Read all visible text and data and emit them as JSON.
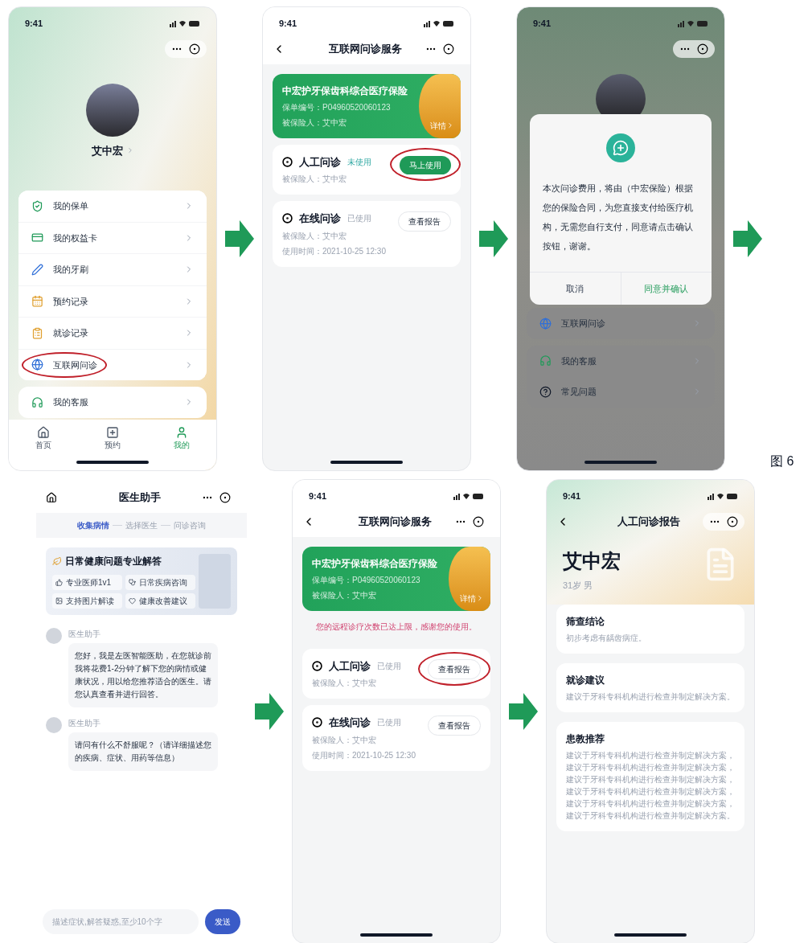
{
  "figure_label": "图 6",
  "screens": [
    {
      "kind": "profile",
      "time": "9:41",
      "user_name": "艾中宏",
      "menu": [
        {
          "label": "我的保单",
          "circled": false
        },
        {
          "label": "我的权益卡",
          "circled": false
        },
        {
          "label": "我的牙刷",
          "circled": false
        },
        {
          "label": "预约记录",
          "circled": false
        },
        {
          "label": "就诊记录",
          "circled": false
        },
        {
          "label": "互联网问诊",
          "circled": true
        }
      ],
      "service_menu": [
        {
          "label": "我的客服"
        }
      ],
      "tabs": [
        {
          "label": "首页",
          "selected": false
        },
        {
          "label": "预约",
          "selected": false
        },
        {
          "label": "我的",
          "selected": true
        }
      ]
    },
    {
      "kind": "service",
      "time": "9:41",
      "title": "互联网问诊服务",
      "card": {
        "title": "中宏护牙保齿科综合医疗保险",
        "number": "保单编号：P04960520060123",
        "insured": "被保险人：艾中宏",
        "detail": "详情"
      },
      "services": [
        {
          "name": "人工问诊",
          "status": "未使用",
          "used": false,
          "lines": [
            "被保险人：艾中宏"
          ],
          "button": {
            "label": "马上使用",
            "primary": true,
            "circled": true
          }
        },
        {
          "name": "在线问诊",
          "status": "已使用",
          "used": true,
          "lines": [
            "被保险人：艾中宏",
            "使用时间：2021-10-25 12:30"
          ],
          "button": {
            "label": "查看报告",
            "primary": false,
            "circled": false
          }
        }
      ]
    },
    {
      "kind": "dialog",
      "time": "9:41",
      "dialog": {
        "message": "本次问诊费用，将由（中宏保险）根据您的保险合同，为您直接支付给医疗机构，无需您自行支付，同意请点击确认按钮，谢谢。",
        "buttons": [
          {
            "label": "取消",
            "kind": "cancel"
          },
          {
            "label": "同意并确认",
            "kind": "confirm"
          }
        ]
      },
      "menu": [
        {
          "label": "互联网问诊"
        }
      ],
      "service_menu": [
        {
          "label": "我的客服"
        },
        {
          "label": "常见问题"
        }
      ]
    },
    {
      "kind": "chat",
      "title": "医生助手",
      "steps": [
        {
          "label": "收集病情",
          "selected": true
        },
        {
          "label": "选择医生",
          "selected": false
        },
        {
          "label": "问诊咨询",
          "selected": false
        }
      ],
      "banner": {
        "title": "日常健康问题专业解答",
        "chips": [
          "专业医师1v1",
          "日常疾病咨询",
          "支持图片解读",
          "健康改善建议"
        ]
      },
      "messages": [
        {
          "sender": "医生助手",
          "text": "您好，我是左医智能医助，在您就诊前我将花费1-2分钟了解下您的病情或健康状况，用以给您推荐适合的医生。请您认真查看并进行回答。"
        },
        {
          "sender": "医生助手",
          "text": "请问有什么不舒服呢？（请详细描述您的疾病、症状、用药等信息）"
        }
      ],
      "input": {
        "placeholder": "描述症状,解答疑惑,至少10个字"
      },
      "send": "发送"
    },
    {
      "kind": "service",
      "time": "9:41",
      "title": "互联网问诊服务",
      "card": {
        "title": "中宏护牙保齿科综合医疗保险",
        "number": "保单编号：P04960520060123",
        "insured": "被保险人：艾中宏",
        "detail": "详情"
      },
      "notice": "您的远程诊疗次数已达上限，感谢您的使用。",
      "services": [
        {
          "name": "人工问诊",
          "status": "已使用",
          "used": true,
          "lines": [
            "被保险人：艾中宏"
          ],
          "button": {
            "label": "查看报告",
            "primary": false,
            "circled": true
          }
        },
        {
          "name": "在线问诊",
          "status": "已使用",
          "used": true,
          "lines": [
            "被保险人：艾中宏",
            "使用时间：2021-10-25 12:30"
          ],
          "button": {
            "label": "查看报告",
            "primary": false,
            "circled": false
          }
        }
      ]
    },
    {
      "kind": "report",
      "time": "9:41",
      "title": "人工问诊报告",
      "name": "艾中宏",
      "info": "31岁 男",
      "sections": [
        {
          "title": "筛查结论",
          "body": "初步考虑有龋齿病症。"
        },
        {
          "title": "就诊建议",
          "body": "建议于牙科专科机构进行检查并制定解决方案。"
        },
        {
          "title": "患教推荐",
          "body": "建议于牙科专科机构进行检查并制定解决方案，建议于牙科专科机构进行检查并制定解决方案，建议于牙科专科机构进行检查并制定解决方案，建议于牙科专科机构进行检查并制定解决方案，建议于牙科专科机构进行检查并制定解决方案，建议于牙科专科机构进行检查并制定解决方案。"
        }
      ]
    }
  ]
}
